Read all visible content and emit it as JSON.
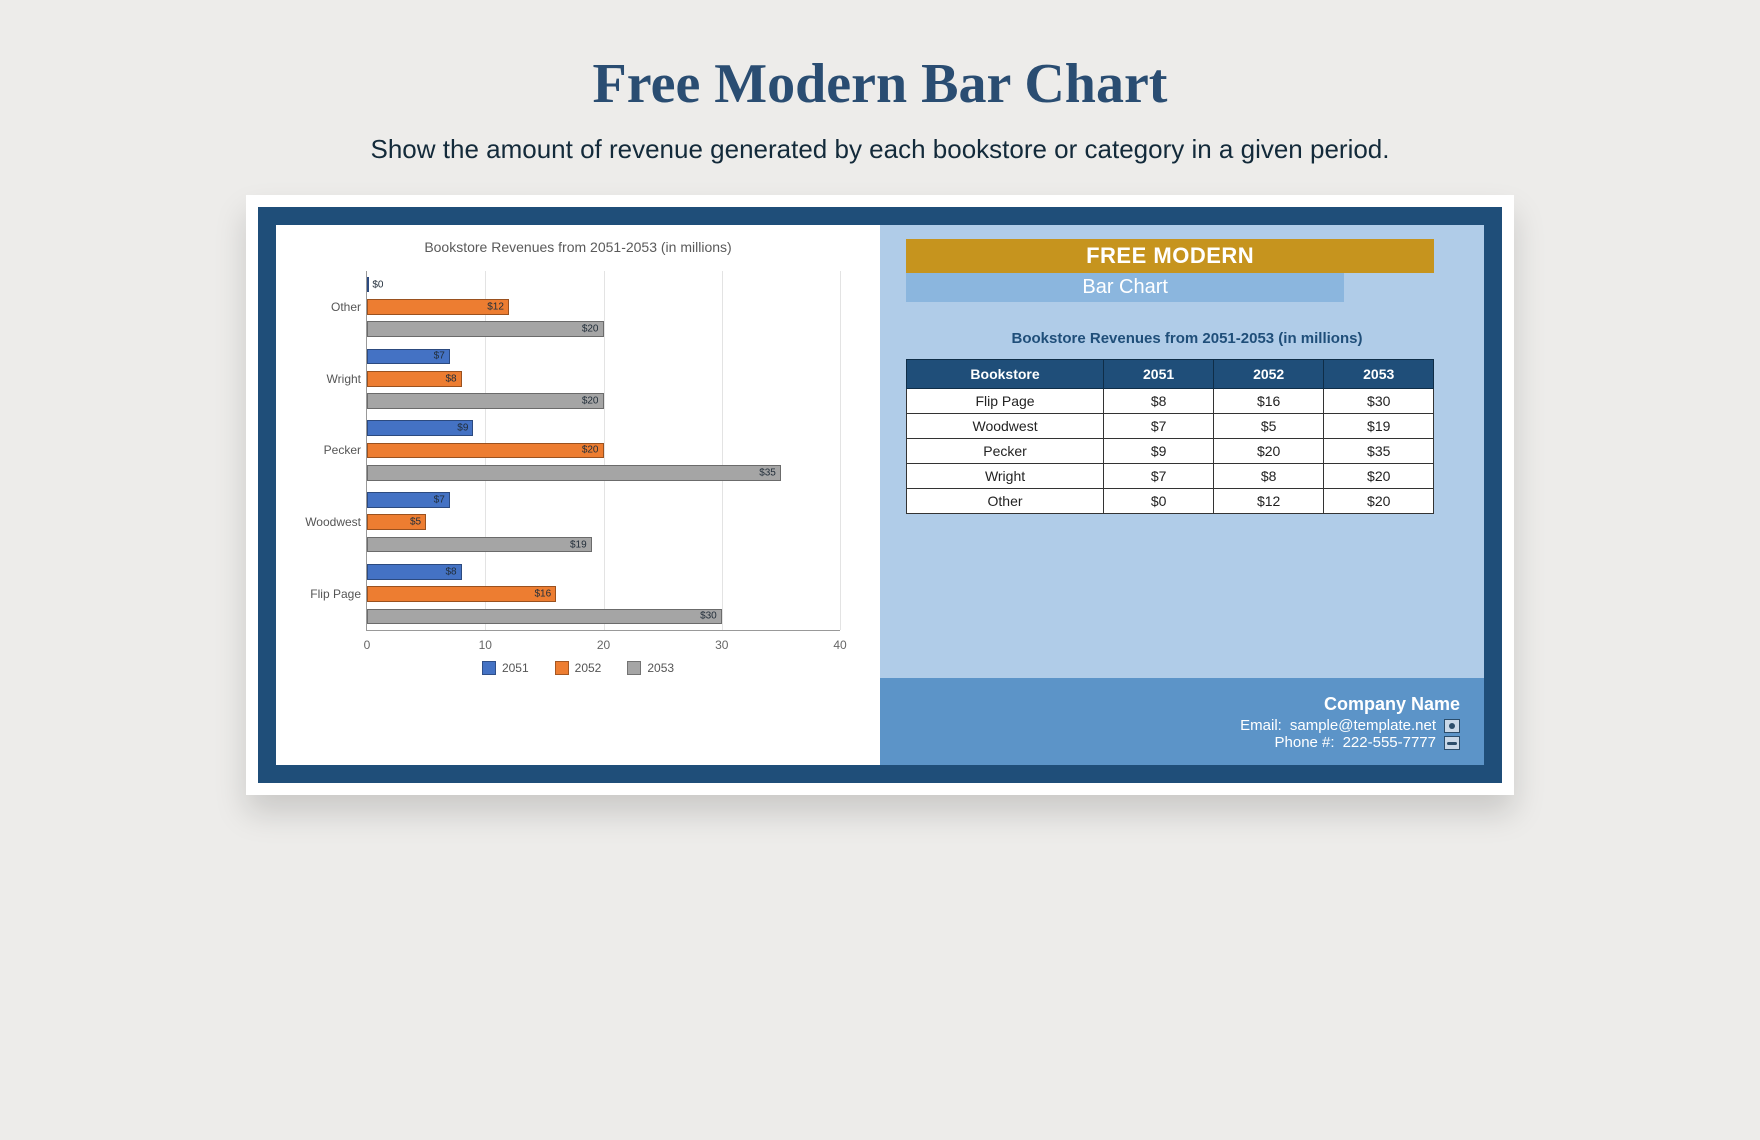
{
  "header": {
    "title": "Free Modern Bar Chart",
    "subtitle": "Show the amount of revenue generated by each bookstore or category in a given period."
  },
  "chart_data": {
    "type": "bar",
    "orientation": "horizontal",
    "title": "Bookstore Revenues from 2051-2053 (in millions)",
    "categories": [
      "Other",
      "Wright",
      "Pecker",
      "Woodwest",
      "Flip Page"
    ],
    "series": [
      {
        "name": "2051",
        "values": [
          0,
          7,
          9,
          7,
          8
        ],
        "color": "#4472c4"
      },
      {
        "name": "2052",
        "values": [
          12,
          8,
          20,
          5,
          16
        ],
        "color": "#ed7d31"
      },
      {
        "name": "2053",
        "values": [
          20,
          20,
          35,
          19,
          30
        ],
        "color": "#a5a5a5"
      }
    ],
    "xlim": [
      0,
      40
    ],
    "xticks": [
      0,
      10,
      20,
      30,
      40
    ],
    "value_prefix": "$"
  },
  "right": {
    "badge_top": "FREE MODERN",
    "badge_sub": "Bar Chart",
    "table_title": "Bookstore Revenues from 2051-2053 (in millions)",
    "columns": [
      "Bookstore",
      "2051",
      "2052",
      "2053"
    ],
    "rows": [
      {
        "name": "Flip Page",
        "v1": "$8",
        "v2": "$16",
        "v3": "$30"
      },
      {
        "name": "Woodwest",
        "v1": "$7",
        "v2": "$5",
        "v3": "$19"
      },
      {
        "name": "Pecker",
        "v1": "$9",
        "v2": "$20",
        "v3": "$35"
      },
      {
        "name": "Wright",
        "v1": "$7",
        "v2": "$8",
        "v3": "$20"
      },
      {
        "name": "Other",
        "v1": "$0",
        "v2": "$12",
        "v3": "$20"
      }
    ],
    "company": "Company Name",
    "email_label": "Email: ",
    "email": "sample@template.net",
    "phone_label": "Phone #: ",
    "phone": "222-555-7777"
  }
}
